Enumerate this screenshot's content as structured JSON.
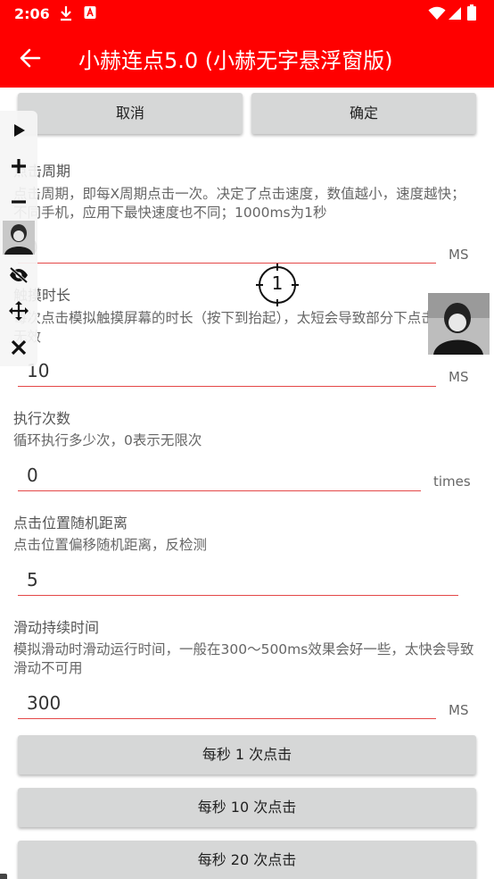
{
  "status": {
    "time": "2:06"
  },
  "app": {
    "title": "小赫连点5.0 (小赫无字悬浮窗版)"
  },
  "buttons": {
    "cancel": "取消",
    "confirm": "确定"
  },
  "fields": [
    {
      "key": "period",
      "label": "点击周期",
      "desc": "点击周期，即每X周期点击一次。决定了点击速度，数值越小，速度越快；不同手机，应用下最快速度也不同；1000ms为1秒",
      "value": "0",
      "unit": "MS"
    },
    {
      "key": "duration",
      "label": "触摸时长",
      "desc": "每次点击模拟触摸屏幕的时长（按下到抬起），太短会导致部分下点击无效",
      "value": "10",
      "unit": "MS"
    },
    {
      "key": "count",
      "label": "执行次数",
      "desc": "循环执行多少次，0表示无限次",
      "value": "0",
      "unit": "times"
    },
    {
      "key": "random",
      "label": "点击位置随机距离",
      "desc": "点击位置偏移随机距离，反检测",
      "value": "5",
      "unit": ""
    },
    {
      "key": "swipe",
      "label": "滑动持续时间",
      "desc": "模拟滑动时滑动运行时间，一般在300～500ms效果会好一些，太快会导致滑动不可用",
      "value": "300",
      "unit": "MS"
    }
  ],
  "presets": [
    "每秒 1 次点击",
    "每秒 10 次点击",
    "每秒 20 次点击"
  ],
  "crosshair": {
    "number": "1"
  },
  "colors": {
    "accent": "#ff0000",
    "underline": "#e44848",
    "button": "#d6d7d7"
  },
  "floating_toolbar": [
    "play-icon",
    "plus-icon",
    "minus-icon",
    "avatar",
    "eye-off-icon",
    "move-icon",
    "close-icon"
  ]
}
